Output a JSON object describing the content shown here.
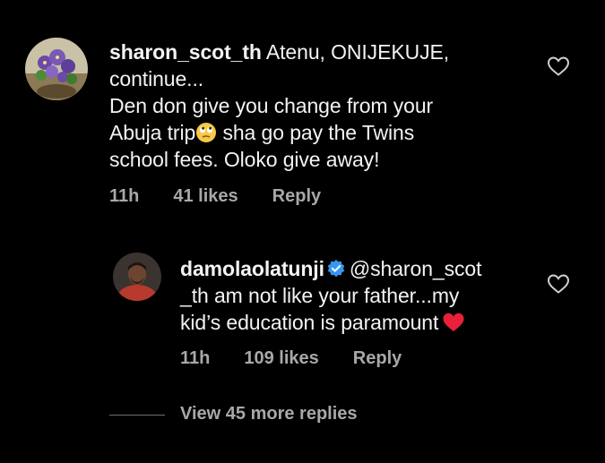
{
  "comments": [
    {
      "username": "sharon_scot_th",
      "text_line1": "Atenu, ONIJEKUJE,",
      "text_line2": "continue...",
      "text_line3": "Den don give you change from your",
      "text_line4a": "Abuja trip",
      "text_line4b": " sha go pay the Twins",
      "text_line5": "school fees. Oloko give away!",
      "time": "11h",
      "likes": "41 likes",
      "reply_label": "Reply",
      "avatar_icon": "flowers-avatar",
      "emoji_icon": "face-rolling-eyes-icon"
    }
  ],
  "reply": {
    "username": "damolaolatunji",
    "verified_icon": "verified-badge-icon",
    "text_line1": "@sharon_scot",
    "text_line2": "_th am not like your father...my",
    "text_line3": "kid’s education is paramount",
    "emoji_icon": "red-heart-icon",
    "time": "11h",
    "likes": "109 likes",
    "reply_label": "Reply",
    "avatar_icon": "profile-photo-avatar"
  },
  "view_more": "View 45 more replies",
  "colors": {
    "background": "#000000",
    "text": "#f3f3f3",
    "muted": "#a8a8a8",
    "verified": "#3797f0",
    "heart": "#e8203a"
  }
}
